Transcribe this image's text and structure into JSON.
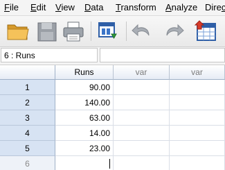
{
  "menu": {
    "items": [
      {
        "pre": "",
        "mn": "F",
        "post": "ile"
      },
      {
        "pre": "",
        "mn": "E",
        "post": "dit"
      },
      {
        "pre": "",
        "mn": "V",
        "post": "iew"
      },
      {
        "pre": "",
        "mn": "D",
        "post": "ata"
      },
      {
        "pre": "",
        "mn": "T",
        "post": "ransform"
      },
      {
        "pre": "",
        "mn": "A",
        "post": "nalyze"
      },
      {
        "pre": "Dire",
        "mn": "c",
        "post": ""
      }
    ]
  },
  "toolbar": {
    "icons": [
      "open-folder-icon",
      "save-icon",
      "print-icon",
      "dialog-recall-icon",
      "undo-icon",
      "redo-icon",
      "goto-case-icon"
    ]
  },
  "cell_editor": {
    "reference": "6 : Runs",
    "value": ""
  },
  "grid": {
    "columns": [
      "Runs",
      "var",
      "var"
    ],
    "rows": [
      {
        "num": "1",
        "runs": "90.00"
      },
      {
        "num": "2",
        "runs": "140.00"
      },
      {
        "num": "3",
        "runs": "63.00"
      },
      {
        "num": "4",
        "runs": "14.00"
      },
      {
        "num": "5",
        "runs": "23.00"
      },
      {
        "num": "6",
        "runs": ""
      }
    ]
  },
  "colors": {
    "row_header_bg": "#d7e3f3",
    "header_bg": "#e6ecf5",
    "grid_line": "#d9dee6"
  }
}
